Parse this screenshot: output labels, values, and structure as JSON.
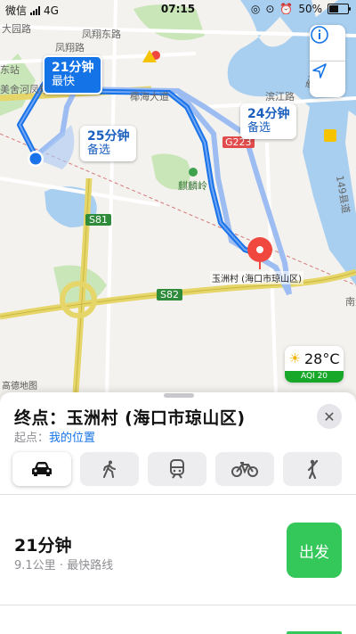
{
  "status_bar": {
    "carrier": "微信",
    "network": "4G",
    "time": "07:15",
    "battery": "50%"
  },
  "map": {
    "place_labels": [
      "大园路",
      "凤翔东路",
      "凤翔路",
      "东站",
      "美舍河凤翔",
      "椰海大道",
      "滨江路",
      "南渡江",
      "麒麟岭",
      "S81",
      "S82",
      "G223",
      "149县道",
      "南渡"
    ],
    "fastest_route": {
      "time": "21分钟",
      "tag": "最快"
    },
    "alt_routes": [
      {
        "time": "25分钟",
        "tag": "备选"
      },
      {
        "time": "24分钟",
        "tag": "备选"
      }
    ],
    "destination_label": "玉洲村 (海口市琼山区)",
    "weather": {
      "temp": "28°C",
      "aqi": "AQI 20"
    },
    "logo": "高德地图",
    "colors": {
      "water": "#a9cff0",
      "green": "#c9e6b8",
      "route_active": "#1a73e8",
      "route_alt": "#9dbdf2",
      "highway": "#e6d66a"
    }
  },
  "sheet": {
    "destination_prefix": "终点：",
    "destination": "玉洲村 (海口市琼山区)",
    "origin_prefix": "起点：",
    "origin": "我的位置",
    "modes": [
      "car-icon",
      "walk-icon",
      "transit-icon",
      "bike-icon",
      "taxi-icon"
    ],
    "active_mode": "car-icon",
    "route": {
      "time": "21分钟",
      "distance": "9.1公里",
      "separator": "·",
      "desc": "最快路线",
      "go_label": "出发"
    },
    "go_color": "#34c759"
  }
}
